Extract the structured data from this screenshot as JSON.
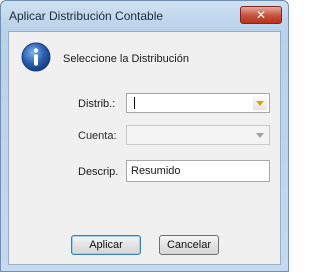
{
  "window": {
    "title": "Aplicar Distribución Contable",
    "close_label": "✕"
  },
  "header": {
    "icon": "info-icon",
    "message": "Seleccione la Distribución"
  },
  "form": {
    "distrib": {
      "label": "Distrib.:",
      "value": ""
    },
    "cuenta": {
      "label": "Cuenta:",
      "value": ""
    },
    "descrip": {
      "label": "Descrip.",
      "value": "Resumido"
    }
  },
  "buttons": {
    "apply": "Aplicar",
    "cancel": "Cancelar"
  },
  "colors": {
    "title_bar": "#b9d1ea",
    "close_button": "#c7503b",
    "dropdown_arrow": "#d9a400",
    "info_icon": "#2a5fb0"
  }
}
